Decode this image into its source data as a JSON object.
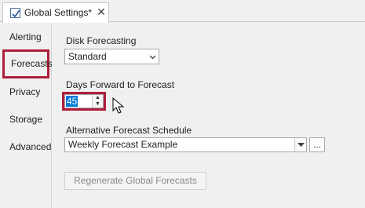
{
  "tab": {
    "title": "Global Settings*",
    "icon": "settings-checkbox-icon",
    "close_glyph": "✕"
  },
  "sidebar": {
    "items": [
      {
        "label": "Alerting",
        "selected": false
      },
      {
        "label": "Forecasts",
        "selected": true
      },
      {
        "label": "Privacy",
        "selected": false
      },
      {
        "label": "Storage",
        "selected": false
      },
      {
        "label": "Advanced",
        "selected": false
      }
    ]
  },
  "disk_forecasting": {
    "label": "Disk Forecasting",
    "selected": "Standard"
  },
  "days_forward": {
    "label": "Days Forward to Forecast",
    "value": "45"
  },
  "alt_schedule": {
    "label": "Alternative Forecast Schedule",
    "selected": "Weekly Forecast Example",
    "browse_label": "..."
  },
  "regenerate_button": {
    "label": "Regenerate Global Forecasts",
    "enabled": false
  },
  "colors": {
    "highlight": "#b01e3c",
    "selection": "#0078d7"
  }
}
